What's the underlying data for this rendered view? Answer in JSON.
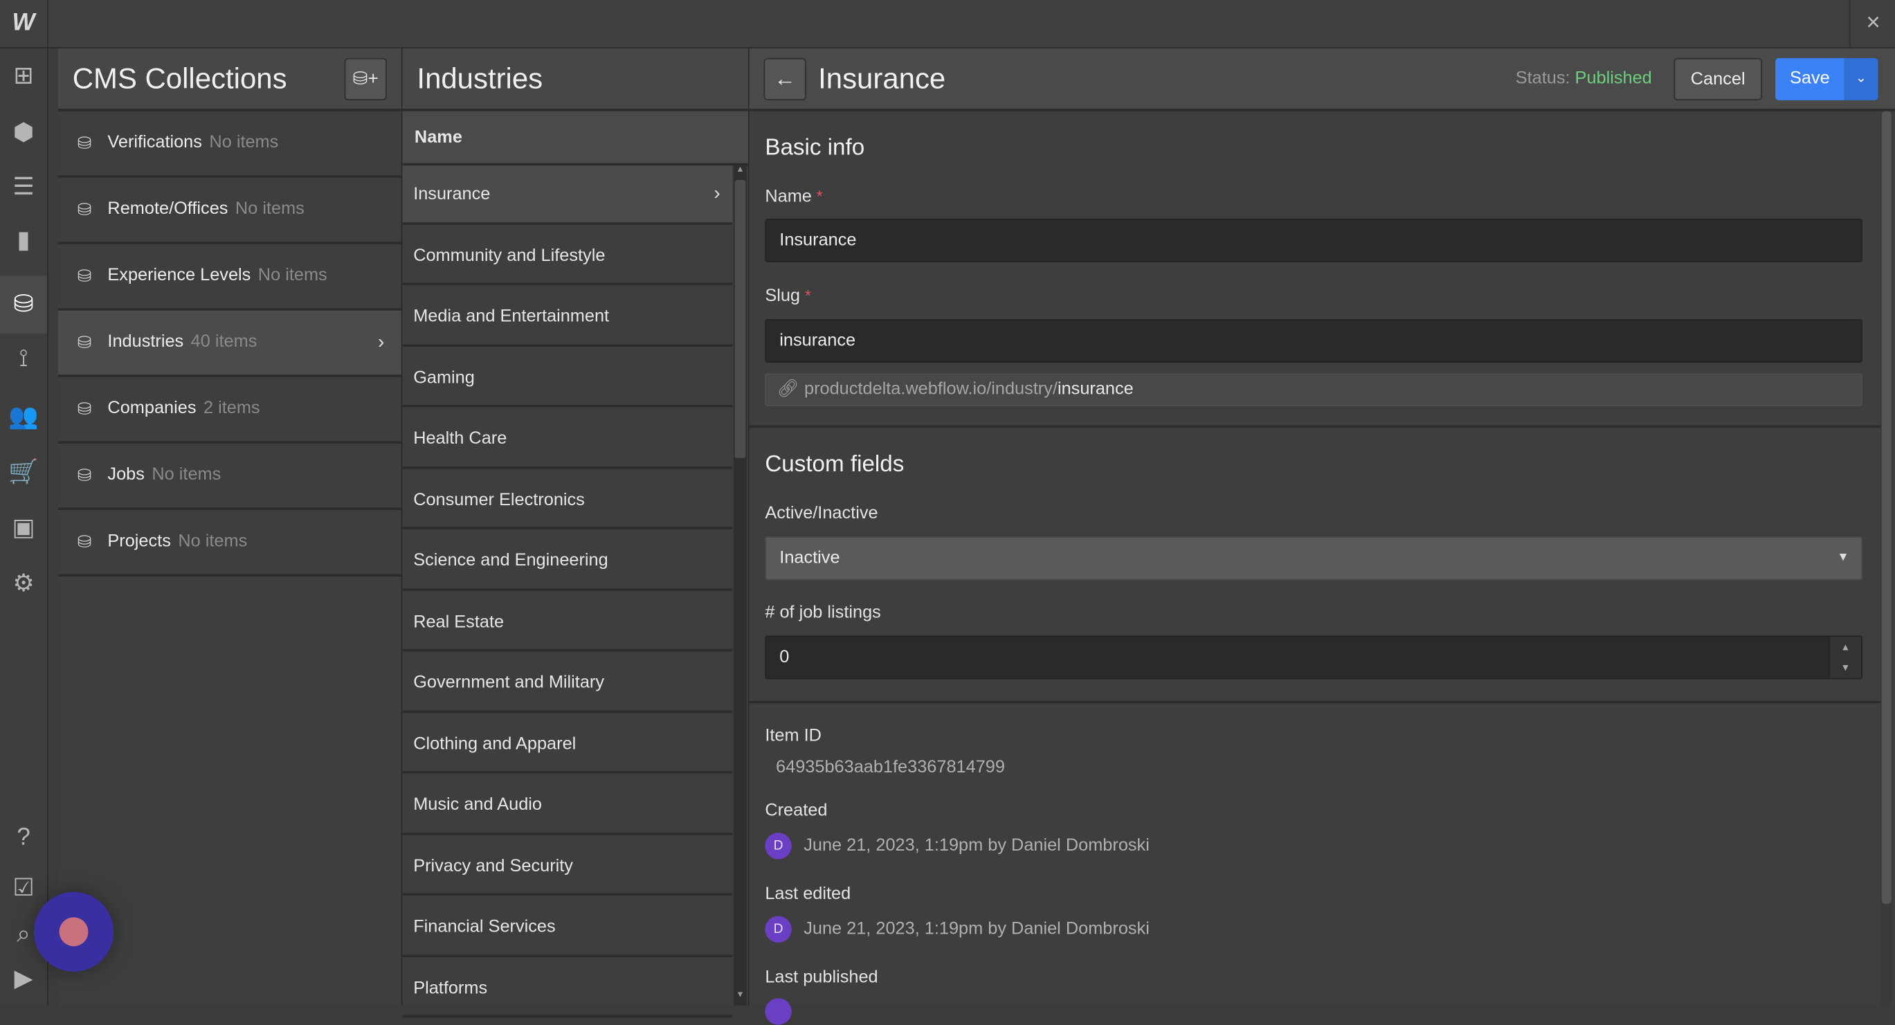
{
  "app": {
    "logo": "W",
    "close_icon": "×"
  },
  "rail": {
    "icons": [
      "add-panel-icon",
      "components-icon",
      "navigator-icon",
      "pages-icon",
      "cms-icon",
      "logic-icon",
      "users-icon",
      "ecommerce-icon",
      "assets-icon",
      "settings-icon",
      "help-icon",
      "tasks-icon",
      "search-icon",
      "video-icon"
    ],
    "active": "cms-icon"
  },
  "cms": {
    "title": "CMS Collections",
    "add_icon": "add-collection-icon",
    "collections": [
      {
        "name": "Verifications",
        "count": "No items"
      },
      {
        "name": "Remote/Offices",
        "count": "No items"
      },
      {
        "name": "Experience Levels",
        "count": "No items"
      },
      {
        "name": "Industries",
        "count": "40 items",
        "selected": true
      },
      {
        "name": "Companies",
        "count": "2 items"
      },
      {
        "name": "Jobs",
        "count": "No items"
      },
      {
        "name": "Projects",
        "count": "No items"
      }
    ]
  },
  "industries": {
    "title": "Industries",
    "column": "Name",
    "items": [
      "Insurance",
      "Community and Lifestyle",
      "Media and Entertainment",
      "Gaming",
      "Health Care",
      "Consumer Electronics",
      "Science and Engineering",
      "Real Estate",
      "Government and Military",
      "Clothing and Apparel",
      "Music and Audio",
      "Privacy and Security",
      "Financial Services",
      "Platforms"
    ],
    "selected": "Insurance"
  },
  "editor": {
    "title": "Insurance",
    "status_label": "Status:",
    "status_value": "Published",
    "status_color": "#6fcf7f",
    "cancel": "Cancel",
    "save": "Save",
    "accent": "#3b82f6",
    "basic_info": "Basic info",
    "name_label": "Name",
    "name_value": "Insurance",
    "slug_label": "Slug",
    "slug_value": "insurance",
    "url_prefix": "productdelta.webflow.io/industry/",
    "url_slug": "insurance",
    "custom_fields": "Custom fields",
    "active_label": "Active/Inactive",
    "active_value": "Inactive",
    "jobs_label": "# of job listings",
    "jobs_value": "0",
    "item_id_label": "Item ID",
    "item_id": "64935b63aab1fe3367814799",
    "created_label": "Created",
    "created_value": "June 21, 2023, 1:19pm by Daniel Dombroski",
    "edited_label": "Last edited",
    "edited_value": "June 21, 2023, 1:19pm by Daniel Dombroski",
    "published_label": "Last published",
    "avatar_initial": "D"
  }
}
